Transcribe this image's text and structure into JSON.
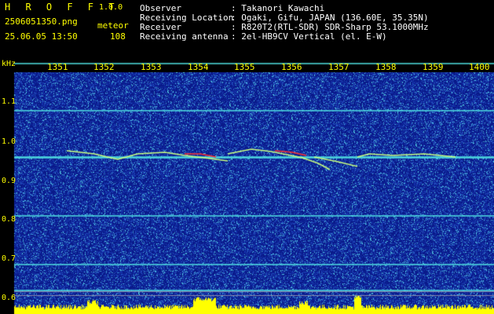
{
  "header": {
    "brand": "H R O F F T",
    "version": "1.0.0",
    "filename": "2506051350.png",
    "datetime": "25.06.05 13:50",
    "mode": "meteor",
    "count": "108",
    "info_labels": [
      "Observer",
      "Receiving Location",
      "Receiver",
      "Receiving antenna"
    ],
    "info_values": [
      ": Takanori Kawachi",
      ": Ogaki, Gifu, JAPAN (136.60E, 35.35N)",
      ": R820T2(RTL-SDR) SDR-Sharp 53.1000MHz",
      ": 2el-HB9CV Vertical (el. E-W)"
    ]
  },
  "axis": {
    "y_unit": "kHz",
    "x_ticks": [
      "1351",
      "1352",
      "1353",
      "1354",
      "1355",
      "1356",
      "1357",
      "1358",
      "1359",
      "1400"
    ],
    "y_ticks": [
      "1.1",
      "1.0",
      "0.9",
      "0.8",
      "0.7",
      "0.6"
    ]
  },
  "colors": {
    "text_yellow": "#ffff00",
    "background": "#000000",
    "spectrum_bg": "#0a1a8a",
    "carrier_line": "#4fe0e0",
    "meteor_trace": "#c8ff80",
    "meteor_hot": "#ff3030",
    "level_bar": "#ffff00"
  }
}
